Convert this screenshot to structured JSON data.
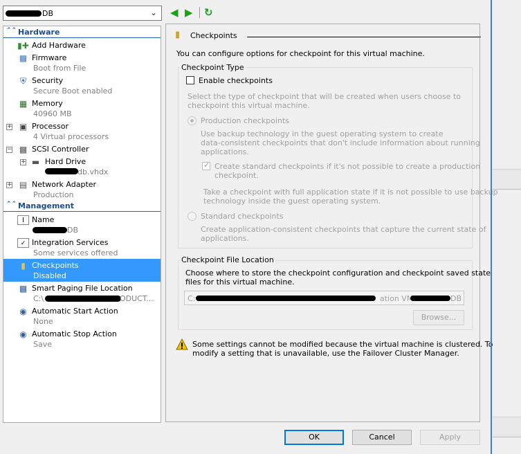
{
  "topbar": {
    "vm_name": "DB"
  },
  "tree": {
    "hardware_label": "Hardware",
    "management_label": "Management",
    "hardware": [
      {
        "title": "Add Hardware",
        "sub": ""
      },
      {
        "title": "Firmware",
        "sub": "Boot from File"
      },
      {
        "title": "Security",
        "sub": "Secure Boot enabled"
      },
      {
        "title": "Memory",
        "sub": "40960 MB"
      },
      {
        "title": "Processor",
        "sub": "4 Virtual processors"
      },
      {
        "title": "SCSI Controller",
        "sub": ""
      },
      {
        "title": "Hard Drive",
        "sub": "db.vhdx"
      },
      {
        "title": "Network Adapter",
        "sub": "Production"
      }
    ],
    "management": [
      {
        "title": "Name",
        "sub": "DB"
      },
      {
        "title": "Integration Services",
        "sub": "Some services offered"
      },
      {
        "title": "Checkpoints",
        "sub": "Disabled"
      },
      {
        "title": "Smart Paging File Location",
        "sub": "C:\\",
        "sub2": "ODUCT..."
      },
      {
        "title": "Automatic Start Action",
        "sub": "None"
      },
      {
        "title": "Automatic Stop Action",
        "sub": "Save"
      }
    ]
  },
  "panel": {
    "title": "Checkpoints",
    "intro": "You can configure options for checkpoint for this virtual machine.",
    "type_group": "Checkpoint Type",
    "enable_label": "Enable checkpoints",
    "select_desc": [
      "Select the type of checkpoint that will be created when users choose to",
      "checkpoint this virtual machine."
    ],
    "production_label": "Production checkpoints",
    "production_desc": [
      "Use backup technology in the guest operating system to create",
      "data-consistent checkpoints that don't include information about running",
      "applications."
    ],
    "create_standard_label": [
      "Create standard checkpoints if it's not possible to create a production",
      "checkpoint."
    ],
    "take_desc": [
      "Take a checkpoint with full application state if it is not possible to use backup",
      "technology inside the guest operating system."
    ],
    "standard_label": "Standard checkpoints",
    "standard_desc": [
      "Create application-consistent checkpoints that capture the current state of",
      "applications."
    ],
    "file_group": "Checkpoint File Location",
    "file_desc": [
      "Choose where to store the checkpoint configuration and checkpoint saved state",
      "files for this virtual machine."
    ],
    "path_start": "C:",
    "path_mid": "ation VM",
    "path_end": "DB",
    "browse_label": "Browse...",
    "warning": [
      "Some settings cannot be modified because the virtual machine is clustered. To",
      "modify a setting that is unavailable, use the Failover Cluster Manager."
    ]
  },
  "footer": {
    "ok": "OK",
    "cancel": "Cancel",
    "apply": "Apply"
  },
  "colors": {
    "selection": "#3399ff",
    "section_blue": "#1d4d8f",
    "nav_green": "#1aa11a"
  }
}
